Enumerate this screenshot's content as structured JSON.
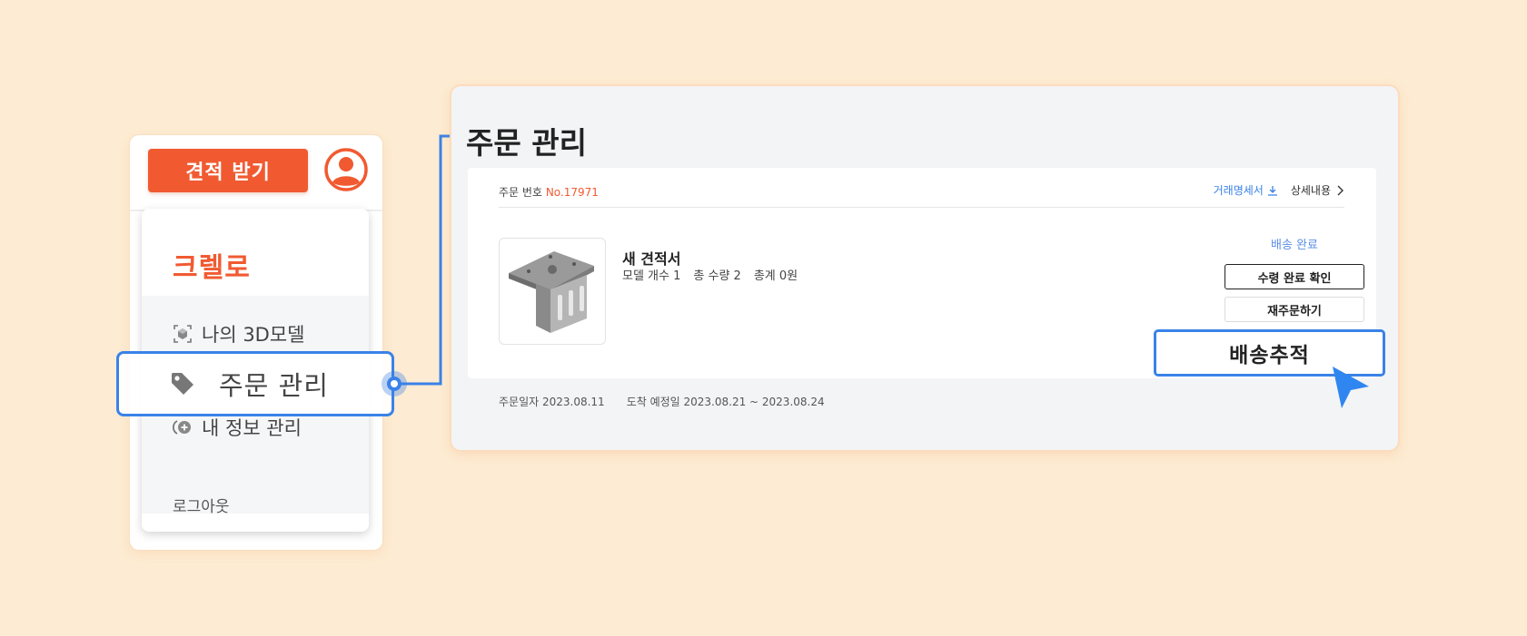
{
  "menu": {
    "quote_button": "견적 받기",
    "brand": "크렐로",
    "items": [
      {
        "label": "나의 3D모델",
        "icon": "cube-scan-icon"
      },
      {
        "label": "주문 관리",
        "icon": "tag-icon"
      },
      {
        "label": "내 정보 관리",
        "icon": "user-plus-icon"
      }
    ],
    "logout": "로그아웃"
  },
  "highlight": {
    "label": "주문 관리"
  },
  "panel": {
    "title": "주문 관리",
    "order": {
      "number_label": "주문 번호",
      "number": "No.17971",
      "invoice_link": "거래명세서",
      "detail_link": "상세내용",
      "quote_title": "새 견적서",
      "meta": [
        "모델 개수 1",
        "총 수량 2",
        "총계 0원"
      ],
      "status": "배송 완료",
      "receive_button": "수령 완료 확인",
      "reorder_button": "재주문하기",
      "order_date": "주문일자 2023.08.11",
      "arrival": "도착 예정일 2023.08.21 ~ 2023.08.24"
    },
    "track_button": "배송추적"
  },
  "colors": {
    "background": "#fdecd3",
    "accent": "#f15a31",
    "highlight": "#3a82e8",
    "status": "#5b8fe6"
  }
}
